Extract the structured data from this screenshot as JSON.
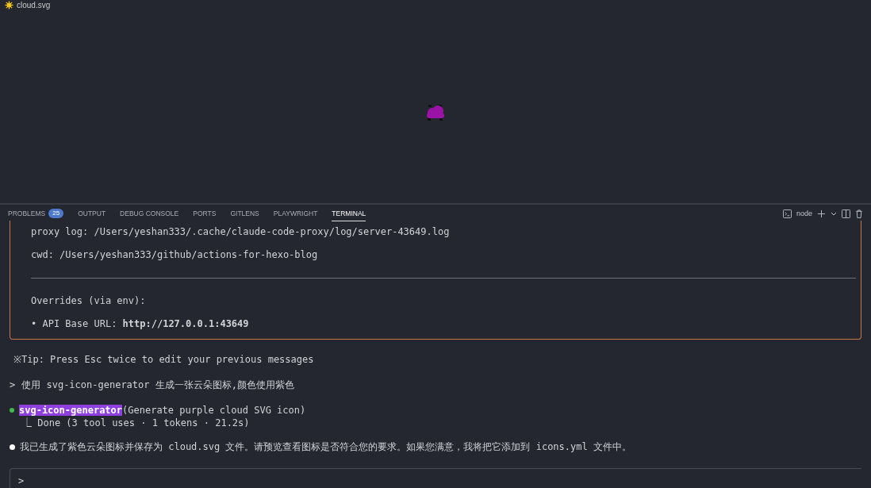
{
  "editor": {
    "tab_title": "cloud.svg"
  },
  "panel": {
    "tabs": [
      {
        "label": "PROBLEMS",
        "badge": "25",
        "selected": false
      },
      {
        "label": "OUTPUT",
        "selected": false
      },
      {
        "label": "DEBUG CONSOLE",
        "selected": false
      },
      {
        "label": "PORTS",
        "selected": false
      },
      {
        "label": "GITLENS",
        "selected": false
      },
      {
        "label": "PLAYWRIGHT",
        "selected": false
      },
      {
        "label": "TERMINAL",
        "selected": true
      }
    ],
    "terminal_name": "node"
  },
  "terminal": {
    "info_box": [
      {
        "kind": "text",
        "text": "proxy log: /Users/yeshan333/.cache/claude-code-proxy/log/server-43649.log"
      },
      {
        "kind": "text",
        "text": "cwd: /Users/yeshan333/github/actions-for-hexo-blog"
      },
      {
        "kind": "rule"
      },
      {
        "kind": "text",
        "text": "Overrides (via env):"
      },
      {
        "kind": "text",
        "text": "• API Base URL: **http://127.0.0.1:43649**"
      }
    ],
    "tip": "※Tip: Press Esc twice to edit your previous messages",
    "user_prompt": {
      "marker": ">",
      "text": "使用 svg-icon-generator 生成一张云朵图标,颜色使用紫色"
    },
    "tool_call": {
      "name": "svg-icon-generator",
      "args": "(Generate purple cloud SVG icon)",
      "status": "⎿ Done (3 tool uses · 1 tokens · 21.2s)",
      "color": "#3fb950"
    },
    "reply": {
      "text": "我已生成了紫色云朵图标并保存为 cloud.svg 文件。请预览查看图标是否符合您的要求。如果您满意，我将把它添加到 icons.yml 文件中。",
      "color": "#ffffff"
    },
    "input": {
      "marker": ">"
    }
  }
}
